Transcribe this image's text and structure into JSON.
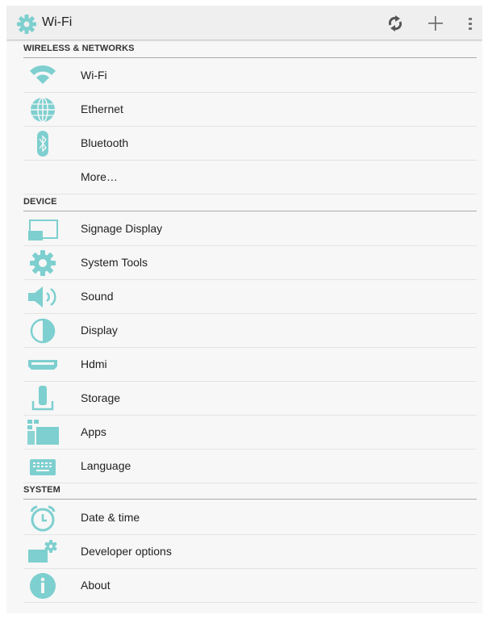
{
  "action_bar": {
    "title": "Wi-Fi",
    "app_icon": "settings-gear-icon",
    "actions": [
      {
        "name": "refresh-icon"
      },
      {
        "name": "add-icon"
      },
      {
        "name": "overflow-menu-icon"
      }
    ]
  },
  "colors": {
    "accent": "#7ecfcf",
    "action_bar_bg": "#efefef",
    "list_bg": "#f7f7f7",
    "divider": "#aaaaaa"
  },
  "sections": [
    {
      "header": "WIRELESS & NETWORKS",
      "items": [
        {
          "label": "Wi-Fi",
          "icon": "wifi-icon"
        },
        {
          "label": "Ethernet",
          "icon": "globe-icon"
        },
        {
          "label": "Bluetooth",
          "icon": "bluetooth-icon"
        },
        {
          "label": "More…",
          "icon": ""
        }
      ]
    },
    {
      "header": "DEVICE",
      "items": [
        {
          "label": "Signage Display",
          "icon": "cast-display-icon"
        },
        {
          "label": "System Tools",
          "icon": "gear-icon"
        },
        {
          "label": "Sound",
          "icon": "speaker-icon"
        },
        {
          "label": "Display",
          "icon": "brightness-icon"
        },
        {
          "label": "Hdmi",
          "icon": "hdmi-icon"
        },
        {
          "label": "Storage",
          "icon": "storage-icon"
        },
        {
          "label": "Apps",
          "icon": "apps-icon"
        },
        {
          "label": "Language",
          "icon": "keyboard-icon"
        }
      ]
    },
    {
      "header": "SYSTEM",
      "items": [
        {
          "label": "Date & time",
          "icon": "alarm-clock-icon"
        },
        {
          "label": "Developer options",
          "icon": "developer-gear-icon"
        },
        {
          "label": "About",
          "icon": "info-icon"
        }
      ]
    }
  ]
}
